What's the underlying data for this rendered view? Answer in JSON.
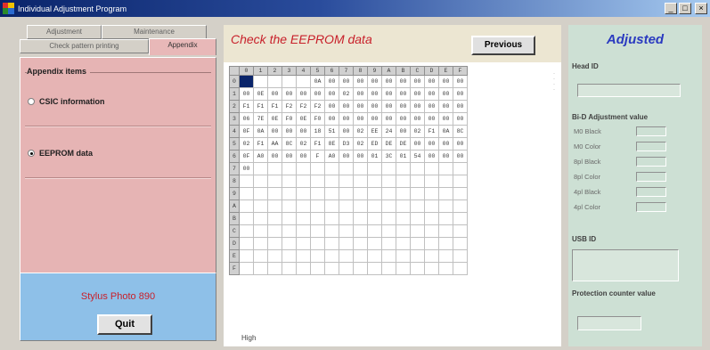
{
  "window": {
    "title": "Individual Adjustment Program",
    "controls": {
      "minimize": "_",
      "maximize": "□",
      "close": "×"
    }
  },
  "left": {
    "tabs_row1": [
      "Adjustment",
      "Maintenance"
    ],
    "tabs_row2": [
      "Check pattern printing",
      "Appendix"
    ],
    "active_tab": "Appendix",
    "group_title": "Appendix items",
    "options": [
      {
        "label": "CSIC information",
        "selected": false
      },
      {
        "label": "EEPROM data",
        "selected": true
      }
    ],
    "model": "Stylus Photo 890",
    "quit_label": "Quit"
  },
  "center": {
    "title": "Check the EEPROM data",
    "previous_label": "Previous",
    "col_headers": [
      "0",
      "1",
      "2",
      "3",
      "4",
      "5",
      "6",
      "7",
      "8",
      "9",
      "A",
      "B",
      "C",
      "D",
      "E",
      "F"
    ],
    "row_headers": [
      "0",
      "1",
      "2",
      "3",
      "4",
      "5",
      "6",
      "7",
      "8",
      "9",
      "A",
      "B",
      "C",
      "D",
      "E",
      "F"
    ],
    "rows": [
      [
        "",
        "",
        "",
        "",
        "",
        "0A",
        "00",
        "00",
        "00",
        "00",
        "00",
        "00",
        "00",
        "00",
        "00",
        "00"
      ],
      [
        "00",
        "0E",
        "00",
        "00",
        "00",
        "00",
        "00",
        "02",
        "00",
        "00",
        "00",
        "00",
        "00",
        "00",
        "00",
        "00"
      ],
      [
        "F1",
        "F1",
        "F1",
        "F2",
        "F2",
        "F2",
        "00",
        "00",
        "00",
        "00",
        "00",
        "00",
        "00",
        "00",
        "00",
        "00"
      ],
      [
        "06",
        "7E",
        "0E",
        "F0",
        "0E",
        "F0",
        "00",
        "00",
        "00",
        "00",
        "00",
        "00",
        "00",
        "00",
        "00",
        "00"
      ],
      [
        "0F",
        "0A",
        "00",
        "00",
        "00",
        "18",
        "51",
        "00",
        "02",
        "EE",
        "24",
        "00",
        "02",
        "F1",
        "0A",
        "8C"
      ],
      [
        "02",
        "F1",
        "AA",
        "8C",
        "02",
        "F1",
        "8E",
        "D3",
        "02",
        "ED",
        "DE",
        "DE",
        "00",
        "00",
        "00",
        "00"
      ],
      [
        "0F",
        "A0",
        "00",
        "00",
        "00",
        "F",
        "A0",
        "00",
        "00",
        "01",
        "3C",
        "01",
        "54",
        "00",
        "00",
        "00"
      ],
      [
        "00",
        "",
        "",
        "",
        "",
        "",
        "",
        "",
        "",
        "",
        "",
        "",
        "",
        "",
        "",
        ""
      ],
      [
        "",
        "",
        "",
        "",
        "",
        "",
        "",
        "",
        "",
        "",
        "",
        "",
        "",
        "",
        "",
        ""
      ],
      [
        "",
        "",
        "",
        "",
        "",
        "",
        "",
        "",
        "",
        "",
        "",
        "",
        "",
        "",
        "",
        ""
      ],
      [
        "",
        "",
        "",
        "",
        "",
        "",
        "",
        "",
        "",
        "",
        "",
        "",
        "",
        "",
        "",
        ""
      ],
      [
        "",
        "",
        "",
        "",
        "",
        "",
        "",
        "",
        "",
        "",
        "",
        "",
        "",
        "",
        "",
        ""
      ],
      [
        "",
        "",
        "",
        "",
        "",
        "",
        "",
        "",
        "",
        "",
        "",
        "",
        "",
        "",
        "",
        ""
      ],
      [
        "",
        "",
        "",
        "",
        "",
        "",
        "",
        "",
        "",
        "",
        "",
        "",
        "",
        "",
        "",
        ""
      ],
      [
        "",
        "",
        "",
        "",
        "",
        "",
        "",
        "",
        "",
        "",
        "",
        "",
        "",
        "",
        "",
        ""
      ],
      [
        "",
        "",
        "",
        "",
        "",
        "",
        "",
        "",
        "",
        "",
        "",
        "",
        "",
        "",
        "",
        ""
      ]
    ],
    "footer": "High"
  },
  "right": {
    "title": "Adjusted",
    "head_id_label": "Head ID",
    "bid_label": "Bi-D Adjustment value",
    "bid_rows": [
      "M0 Black",
      "M0 Color",
      "8pl Black",
      "8pl Color",
      "4pl Black",
      "4pl Color"
    ],
    "usb_label": "USB ID",
    "protection_label": "Protection counter value"
  },
  "colors": {
    "title_bar": "#0a246a",
    "tab_content": "#e6b4b4",
    "bottom_box": "#8ec0e8",
    "accent_red": "#c8202a",
    "adjusted_blue": "#2a3ac0",
    "right_panel": "#cde0d4"
  }
}
